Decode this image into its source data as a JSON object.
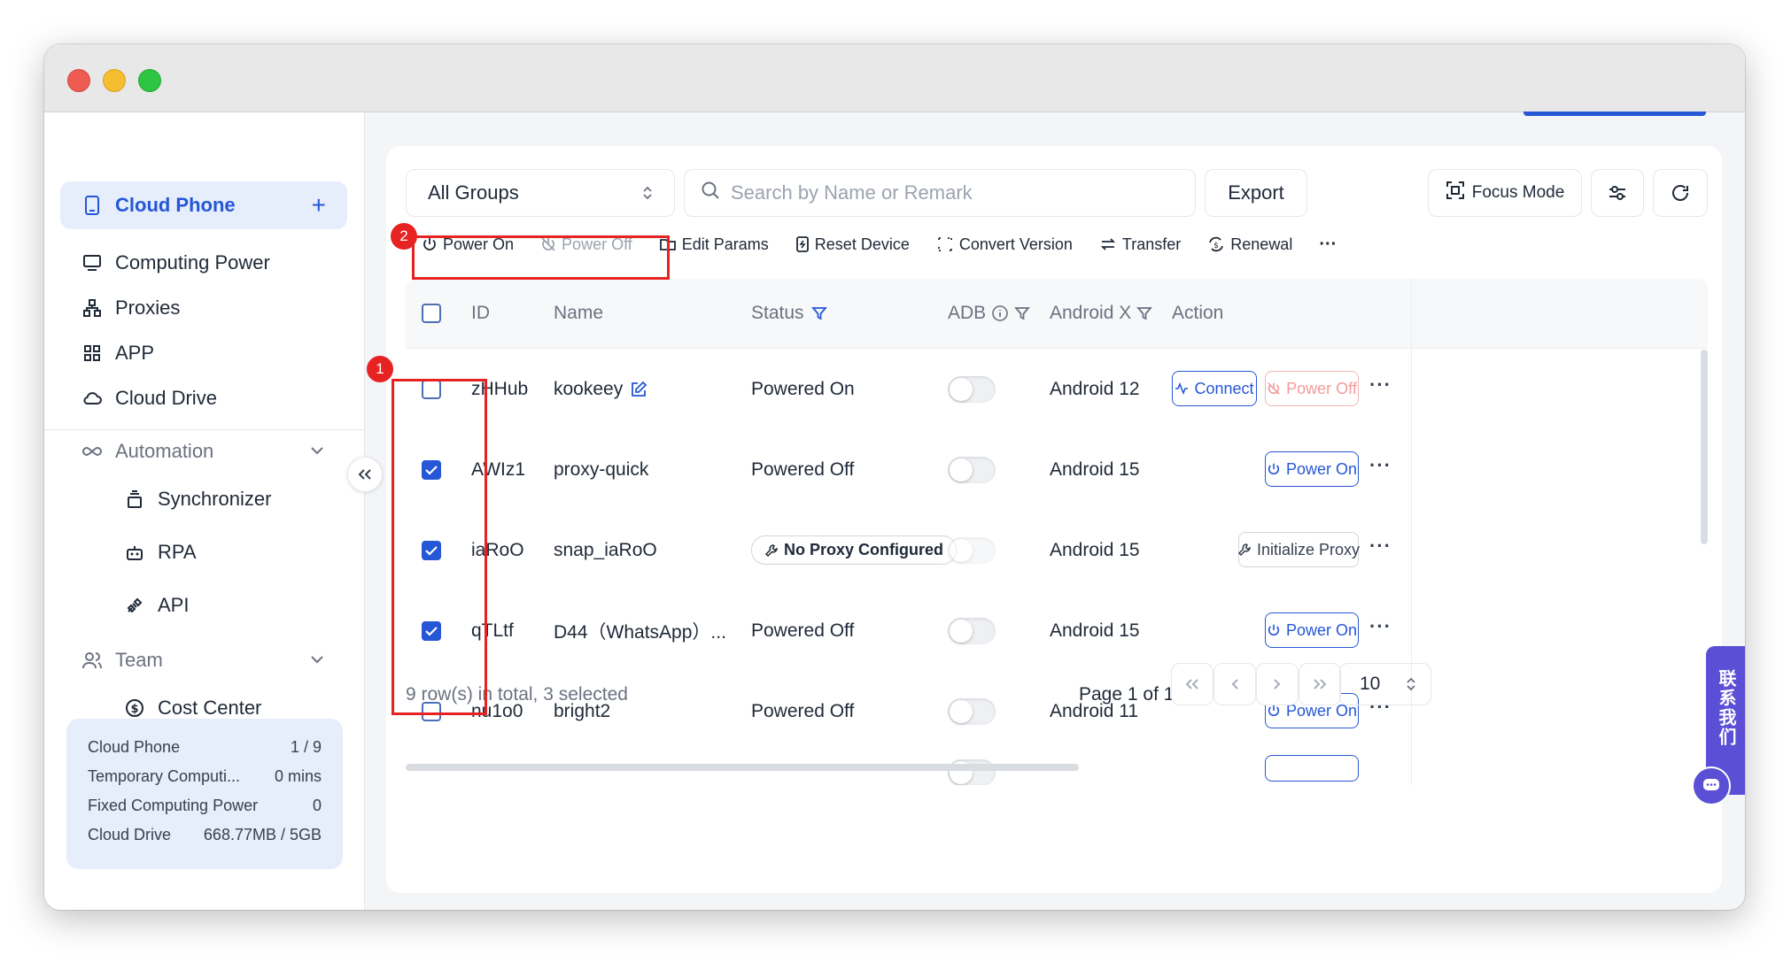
{
  "sidebar": {
    "items": [
      {
        "label": "Cloud Phone"
      },
      {
        "label": "Computing Power"
      },
      {
        "label": "Proxies"
      },
      {
        "label": "APP"
      },
      {
        "label": "Cloud Drive"
      }
    ],
    "automation": {
      "label": "Automation",
      "children": [
        {
          "label": "Synchronizer"
        },
        {
          "label": "RPA"
        },
        {
          "label": "API"
        }
      ]
    },
    "team": {
      "label": "Team",
      "children": [
        {
          "label": "Cost Center"
        }
      ]
    },
    "usage": [
      {
        "label": "Cloud Phone",
        "value": "1 / 9"
      },
      {
        "label": "Temporary Computi...",
        "value": "0 mins"
      },
      {
        "label": "Fixed Computing Power",
        "value": "0"
      },
      {
        "label": "Cloud Drive",
        "value": "668.77MB / 5GB"
      }
    ]
  },
  "filters": {
    "group_select": "All Groups",
    "search_placeholder": "Search by Name or Remark",
    "export_label": "Export",
    "focus_mode_label": "Focus Mode"
  },
  "toolbar": {
    "power_on": "Power On",
    "power_off": "Power Off",
    "edit_params": "Edit Params",
    "reset_device": "Reset Device",
    "convert_version": "Convert Version",
    "transfer": "Transfer",
    "renewal": "Renewal"
  },
  "annotations": {
    "badge1": "1",
    "badge2": "2"
  },
  "table": {
    "columns": {
      "id": "ID",
      "name": "Name",
      "status": "Status",
      "adb": "ADB",
      "android": "Android X",
      "action": "Action"
    },
    "rows": [
      {
        "id": "zHHub",
        "name": "kookeey",
        "status": "Powered On",
        "android": "Android 12",
        "checked": false,
        "actions": [
          "Connect",
          "Power Off"
        ]
      },
      {
        "id": "AWIz1",
        "name": "proxy-quick",
        "status": "Powered Off",
        "android": "Android 15",
        "checked": true,
        "actions": [
          "Power On"
        ]
      },
      {
        "id": "iaRoO",
        "name": "snap_iaRoO",
        "status": "No Proxy Configured",
        "android": "Android 15",
        "checked": true,
        "actions": [
          "Initialize Proxy"
        ]
      },
      {
        "id": "qTLtf",
        "name": "D44（WhatsApp）...",
        "status": "Powered Off",
        "android": "Android 15",
        "checked": true,
        "actions": [
          "Power On"
        ]
      },
      {
        "id": "nu1o0",
        "name": "bright2",
        "status": "Powered Off",
        "android": "Android 11",
        "checked": false,
        "actions": [
          "Power On"
        ]
      }
    ]
  },
  "footer": {
    "summary": "9 row(s) in total, 3 selected",
    "page_info": "Page 1 of 1",
    "page_size": "10"
  },
  "contact": {
    "label": "联系我们"
  },
  "colors": {
    "accent": "#2557d6",
    "annotation_red": "#e62222",
    "contact_purple": "#5b4fd6"
  }
}
